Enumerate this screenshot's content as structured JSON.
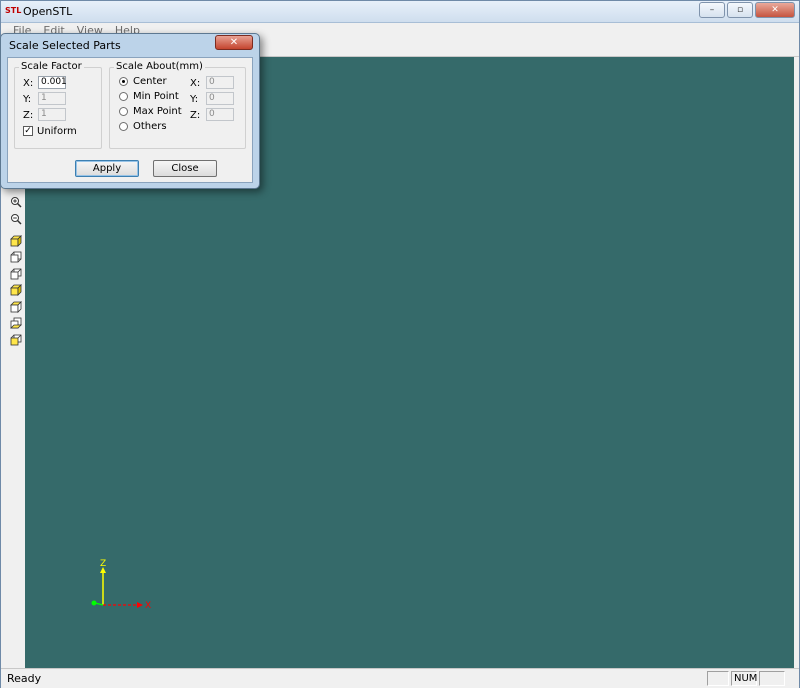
{
  "window": {
    "logo": "STL",
    "title": "OpenSTL",
    "min_glyph": "–",
    "max_glyph": "▫",
    "close_glyph": "✕"
  },
  "menu": {
    "items": [
      "File",
      "Edit",
      "View",
      "Help"
    ]
  },
  "side_toolbar": {
    "icons": [
      "zoom-in-icon",
      "zoom-out-icon",
      "cube-view-icon",
      "cube-view-icon",
      "cube-view-icon",
      "cube-view-icon",
      "cube-view-icon",
      "cube-view-icon",
      "cube-view-icon"
    ]
  },
  "viewport": {
    "background": "#356a6a",
    "axis": {
      "z_label": "Z",
      "x_label": "X",
      "z_color": "#ffff00",
      "x_color": "#ff0000",
      "y_color": "#00ff00"
    }
  },
  "dialog": {
    "title": "Scale Selected Parts",
    "close_glyph": "✕",
    "scale_factor": {
      "legend": "Scale Factor",
      "x_label": "X:",
      "x_value": "0.001",
      "y_label": "Y:",
      "y_value": "1",
      "z_label": "Z:",
      "z_value": "1",
      "uniform_label": "Uniform",
      "uniform_checked": true
    },
    "scale_about": {
      "legend": "Scale About(mm)",
      "options": [
        "Center",
        "Min Point",
        "Max Point",
        "Others"
      ],
      "selected": "Center",
      "x_label": "X:",
      "x_value": "0",
      "y_label": "Y:",
      "y_value": "0",
      "z_label": "Z:",
      "z_value": "0"
    },
    "apply_label": "Apply",
    "close_label": "Close"
  },
  "statusbar": {
    "text": "Ready",
    "num": "NUM"
  }
}
